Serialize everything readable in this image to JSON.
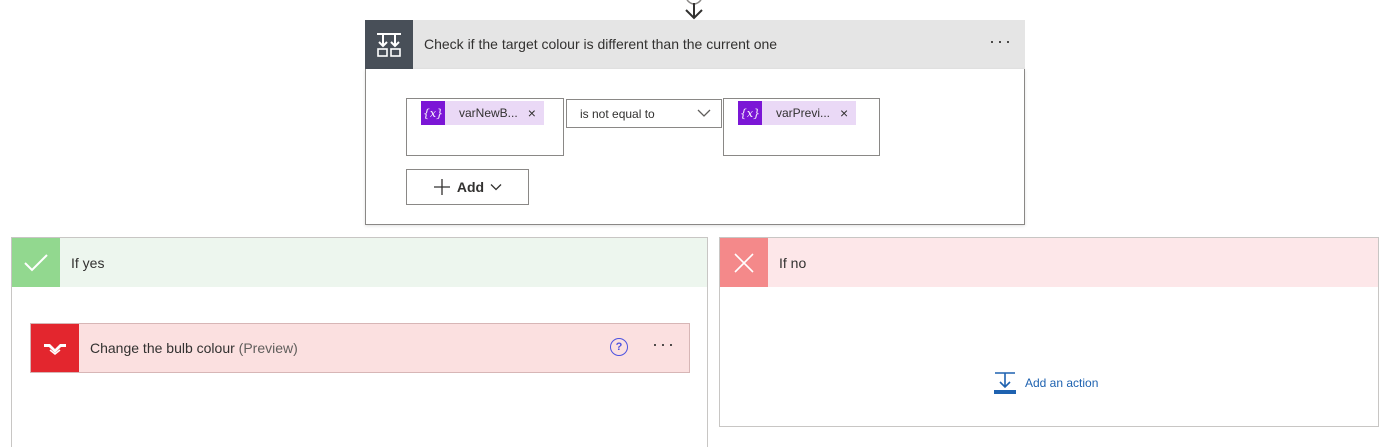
{
  "condition": {
    "title": "Check if the target colour is different than the current one",
    "menu": "···",
    "left_token": {
      "icon_text": "{x}",
      "label": "varNewB...",
      "remove": "×"
    },
    "operator": "is not equal to",
    "right_token": {
      "icon_text": "{x}",
      "label": "varPrevi...",
      "remove": "×"
    },
    "add_label": "Add"
  },
  "branch_yes": {
    "title": "If yes",
    "action": {
      "title": "Change the bulb colour",
      "suffix": "(Preview)",
      "help": "?",
      "menu": "···"
    }
  },
  "branch_no": {
    "title": "If no",
    "add_action_label": "Add an action"
  },
  "colors": {
    "condition_icon_bg": "#484f58",
    "token_purple": "#7b16d6",
    "token_bg": "#ead9f6",
    "yes_accent": "#92d88f",
    "yes_header_bg": "#edf6ee",
    "no_accent": "#f4898a",
    "no_header_bg": "#fde7e9",
    "action_brand": "#e3262e",
    "link_blue": "#1e62b0"
  },
  "icons": {
    "connector": "arrow-down-icon",
    "condition": "condition-icon",
    "yes": "checkmark-icon",
    "no": "close-icon",
    "action": "yeelight-logo-icon",
    "add_action": "add-action-icon"
  }
}
